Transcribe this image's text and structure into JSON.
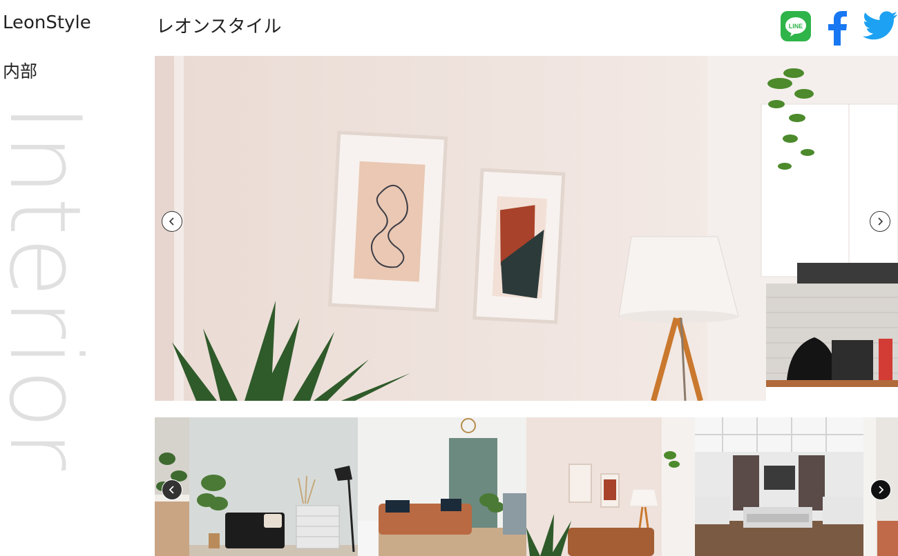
{
  "sidebar": {
    "brand": "LeonStyle",
    "section": "内部",
    "watermark": "Interior"
  },
  "header": {
    "title": "レオンスタイル",
    "social": [
      {
        "name": "line",
        "label": "LINE",
        "color": "#2fb449"
      },
      {
        "name": "facebook",
        "label": "f",
        "color": "#1877f2"
      },
      {
        "name": "twitter",
        "color": "#1da1f2"
      }
    ]
  },
  "main_slider": {
    "slide": "living-room-wall-art"
  },
  "thumbnails": [
    {
      "scene": "plants-corner"
    },
    {
      "scene": "black-sofa-room"
    },
    {
      "scene": "orange-sofa-green-wall"
    },
    {
      "scene": "wall-art-orange-sofa"
    },
    {
      "scene": "coffered-ceiling-living-room"
    },
    {
      "scene": "partial-room"
    }
  ],
  "colors": {
    "wall": "#efe3dd",
    "watermark": "#e0e0e0",
    "accent_dark": "#111111"
  }
}
